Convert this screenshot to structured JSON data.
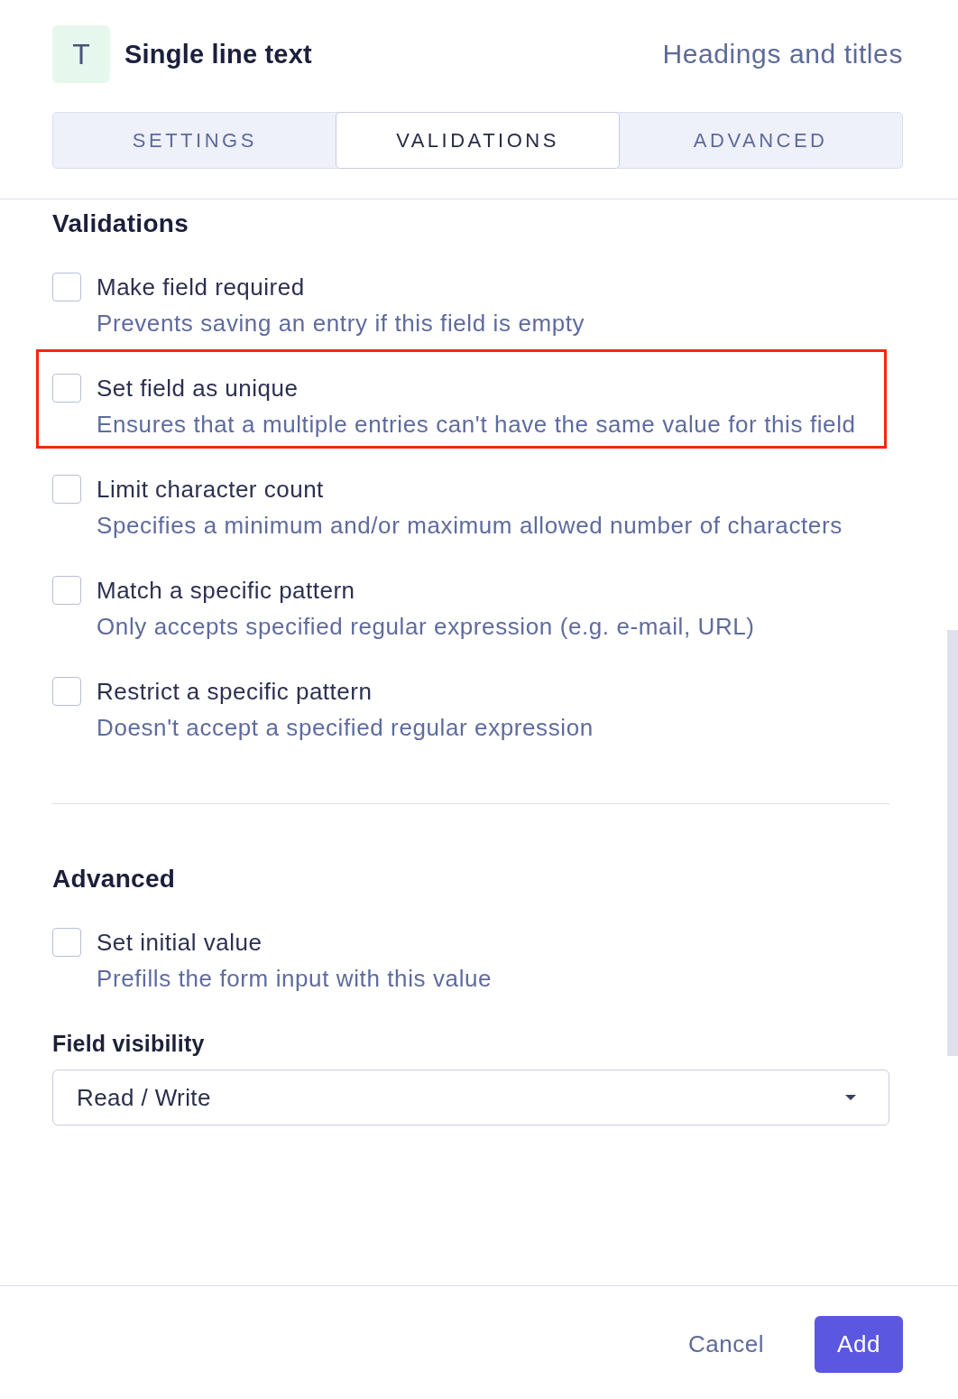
{
  "header": {
    "icon_letter": "T",
    "title": "Single line text",
    "category": "Headings and titles"
  },
  "tabs": [
    {
      "label": "SETTINGS",
      "selected": false
    },
    {
      "label": "VALIDATIONS",
      "selected": true
    },
    {
      "label": "ADVANCED",
      "selected": false
    }
  ],
  "sections": [
    {
      "title": "Validations",
      "options": [
        {
          "label": "Make field required",
          "description": "Prevents saving an entry if this field is empty",
          "checked": false,
          "highlighted": false
        },
        {
          "label": "Set field as unique",
          "description": "Ensures that a multiple entries can't have the same value for this field",
          "checked": false,
          "highlighted": true
        },
        {
          "label": "Limit character count",
          "description": "Specifies a minimum and/or maximum allowed number of characters",
          "checked": false,
          "highlighted": false
        },
        {
          "label": "Match a specific pattern",
          "description": "Only accepts specified regular expression (e.g. e-mail, URL)",
          "checked": false,
          "highlighted": false
        },
        {
          "label": "Restrict a specific pattern",
          "description": "Doesn't accept a specified regular expression",
          "checked": false,
          "highlighted": false
        }
      ]
    },
    {
      "title": "Advanced",
      "options": [
        {
          "label": "Set initial value",
          "description": "Prefills the form input with this value",
          "checked": false,
          "highlighted": false
        }
      ],
      "select": {
        "label": "Field visibility",
        "value": "Read / Write"
      }
    }
  ],
  "footer": {
    "buttons": [
      {
        "label": "Cancel",
        "kind": "secondary"
      },
      {
        "label": "Add",
        "kind": "primary"
      }
    ]
  }
}
